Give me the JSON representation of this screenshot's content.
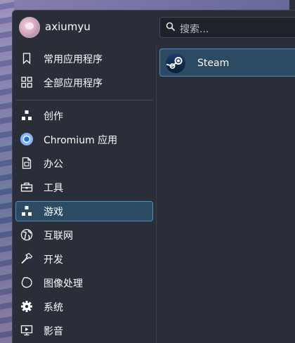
{
  "user": {
    "name": "axiumyu"
  },
  "search": {
    "placeholder": "搜索..."
  },
  "categories": [
    {
      "label": "常用应用程序",
      "icon": "bookmark-icon"
    },
    {
      "label": "全部应用程序",
      "icon": "grid-icon"
    },
    {
      "label": "创作",
      "icon": "graphics-icon"
    },
    {
      "label": "Chromium 应用",
      "icon": "chromium-icon"
    },
    {
      "label": "办公",
      "icon": "office-document-icon"
    },
    {
      "label": "工具",
      "icon": "toolbox-icon"
    },
    {
      "label": "游戏",
      "icon": "games-icon"
    },
    {
      "label": "互联网",
      "icon": "globe-icon"
    },
    {
      "label": "开发",
      "icon": "hammer-icon"
    },
    {
      "label": "图像处理",
      "icon": "graphics-blob-icon"
    },
    {
      "label": "系统",
      "icon": "gear-icon"
    },
    {
      "label": "影音",
      "icon": "multimedia-icon"
    }
  ],
  "selected_category": "游戏",
  "apps": [
    {
      "label": "Steam",
      "icon": "steam-icon"
    }
  ],
  "colors": {
    "panel_bg": "#2a2e38",
    "selection_bg": "#2d4a63",
    "selection_border": "#4e8fbf",
    "text": "#fcfcfc"
  }
}
